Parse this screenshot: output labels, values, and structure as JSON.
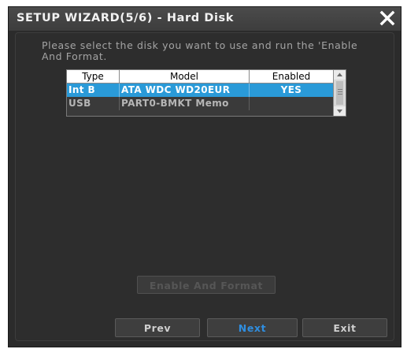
{
  "window": {
    "title": "SETUP WIZARD(5/6) - Hard Disk",
    "close_icon": "close-icon"
  },
  "instructions": "Please select the disk you want to use and run the 'Enable And Format.",
  "disk_table": {
    "columns": [
      "Type",
      "Model",
      "Enabled"
    ],
    "rows": [
      {
        "type": "Int B",
        "model": "ATA WDC WD20EUR",
        "enabled": "YES",
        "selected": true
      },
      {
        "type": "USB",
        "model": "PART0-BMKT Memo",
        "enabled": "",
        "selected": false
      }
    ]
  },
  "buttons": {
    "enable_format": "Enable And Format",
    "prev": "Prev",
    "next": "Next",
    "exit": "Exit"
  },
  "colors": {
    "selection": "#2a9ad8",
    "next_accent": "#2f8ee0",
    "dialog_bg": "#2b2b2b"
  }
}
